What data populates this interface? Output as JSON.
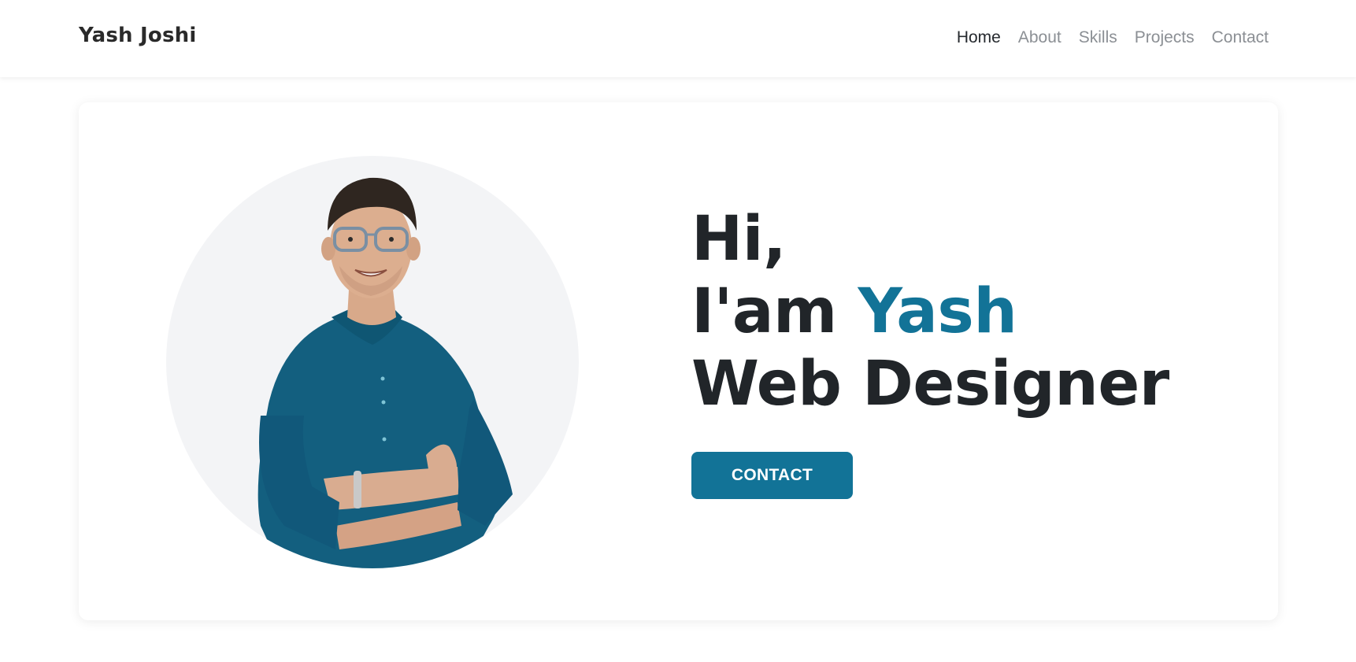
{
  "brand": {
    "name": "Yash Joshi"
  },
  "nav": {
    "items": [
      {
        "label": "Home",
        "active": true
      },
      {
        "label": "About",
        "active": false
      },
      {
        "label": "Skills",
        "active": false
      },
      {
        "label": "Projects",
        "active": false
      },
      {
        "label": "Contact",
        "active": false
      }
    ]
  },
  "hero": {
    "greeting": "Hi,",
    "intro_prefix": "I'am ",
    "intro_name": "Yash",
    "role": "Web Designer",
    "cta_label": "CONTACT"
  },
  "portrait": {
    "icon": "person-portrait-photo",
    "subject": "man with glasses in teal shirt, arms crossed"
  },
  "colors": {
    "accent": "#127397",
    "heading": "#212529",
    "nav_active": "#25292e",
    "nav_inactive": "#8b8f94",
    "portrait_bg": "#f3f4f6",
    "shirt": "#135f7f"
  }
}
